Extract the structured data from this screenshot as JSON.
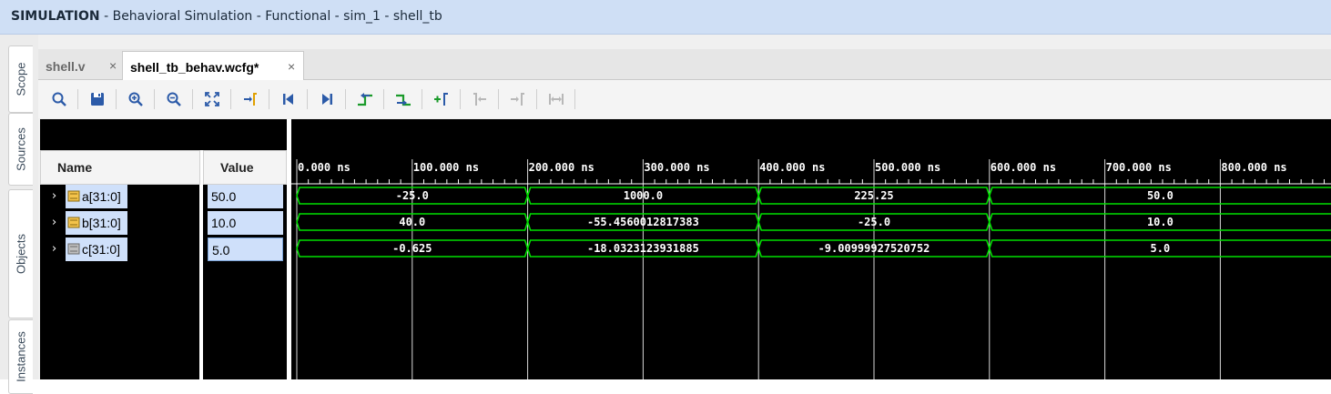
{
  "title": {
    "mode": "SIMULATION",
    "rest": " - Behavioral Simulation - Functional - sim_1 - shell_tb"
  },
  "side_tabs": [
    "Scope",
    "Sources",
    "Objects",
    "Instances"
  ],
  "doc_tabs": [
    {
      "label": "shell.v",
      "active": false
    },
    {
      "label": "shell_tb_behav.wcfg*",
      "active": true
    }
  ],
  "close_glyph": "×",
  "toolbar_icons": [
    "search-icon",
    "save-icon",
    "zoom-in-icon",
    "zoom-out-icon",
    "zoom-fit-icon",
    "go-to-cursor-icon",
    "go-to-start-icon",
    "go-to-end-icon",
    "previous-transition-icon",
    "next-transition-icon",
    "add-marker-icon",
    "previous-marker-icon",
    "next-marker-icon",
    "swap-cursors-icon"
  ],
  "columns": {
    "name": "Name",
    "value": "Value"
  },
  "signals": [
    {
      "name": "a[31:0]",
      "value": "50.0",
      "segments": [
        "-25.0",
        "1000.0",
        "225.25",
        "50.0"
      ]
    },
    {
      "name": "b[31:0]",
      "value": "10.0",
      "segments": [
        "40.0",
        "-55.4560012817383",
        "-25.0",
        "10.0"
      ]
    },
    {
      "name": "c[31:0]",
      "value": "5.0",
      "segments": [
        "-0.625",
        "-18.0323123931885",
        "-9.00999927520752",
        "5.0"
      ]
    }
  ],
  "time_axis": {
    "labels": [
      "0.000 ns",
      "100.000 ns",
      "200.000 ns",
      "300.000 ns",
      "400.000 ns",
      "500.000 ns",
      "600.000 ns",
      "700.000 ns",
      "800.000 ns"
    ],
    "transitions_ns": [
      200,
      400,
      600
    ]
  },
  "colors": {
    "wave": "#00e000",
    "grid": "#ffffff",
    "background": "#000000",
    "selection": "#cfe0fa"
  }
}
